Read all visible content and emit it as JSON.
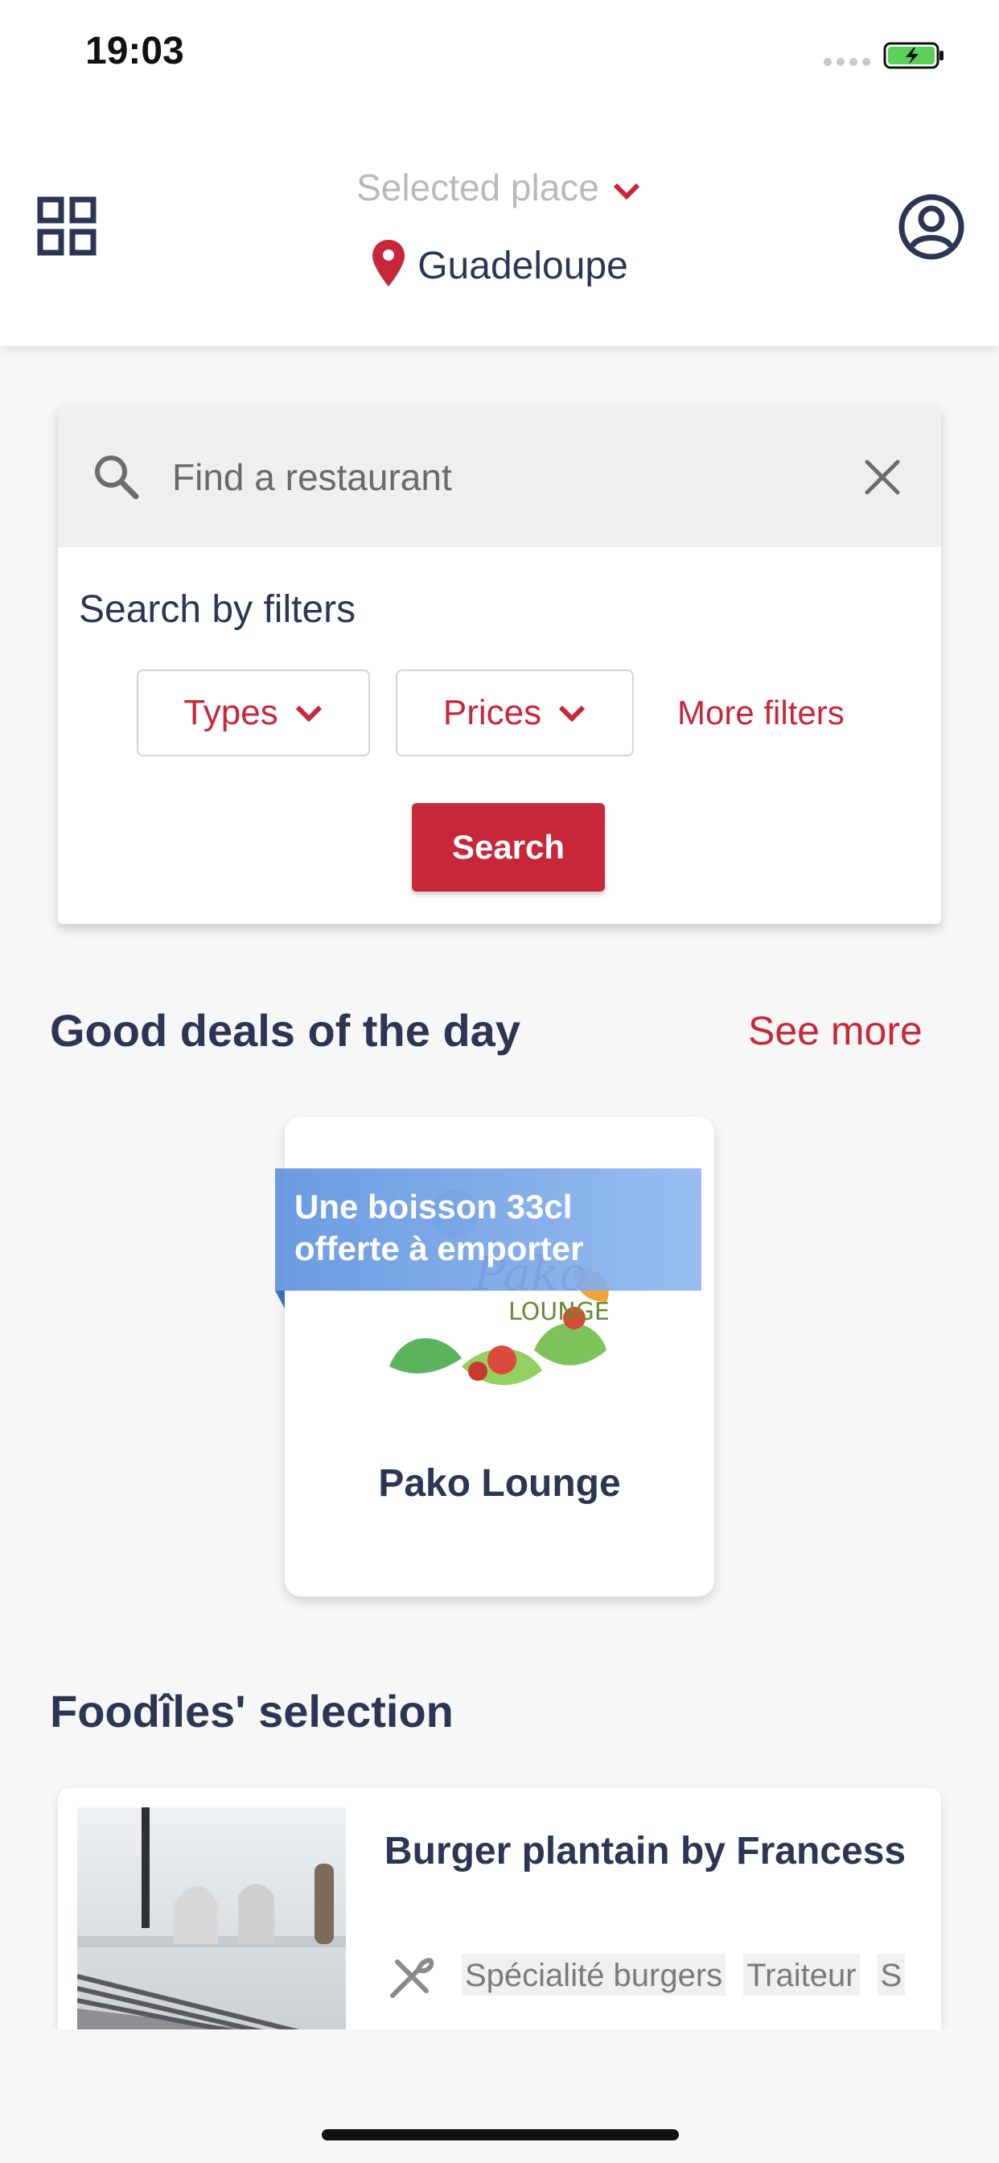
{
  "status_bar": {
    "time": "19:03"
  },
  "header": {
    "selected_place_label": "Selected place",
    "place_name": "Guadeloupe",
    "icons": {
      "menu": "grid-icon",
      "location": "pin-icon",
      "profile": "user-circle-icon"
    }
  },
  "search": {
    "placeholder": "Find a restaurant",
    "filters_title": "Search by filters",
    "types_label": "Types",
    "prices_label": "Prices",
    "more_filters_label": "More filters",
    "search_button_label": "Search"
  },
  "deals": {
    "title": "Good deals of the day",
    "see_more_label": "See more",
    "items": [
      {
        "name": "Pako Lounge",
        "offer": "Une boisson 33cl offerte à emporter"
      }
    ]
  },
  "selection": {
    "title": "Foodîles' selection",
    "items": [
      {
        "name": "Burger plantain by Francess",
        "tags": [
          "Spécialité burgers",
          "Traiteur",
          "S"
        ]
      }
    ]
  },
  "colors": {
    "accent": "#c8273a",
    "text_dark": "#2c3654",
    "ribbon": "#6a9de3"
  }
}
